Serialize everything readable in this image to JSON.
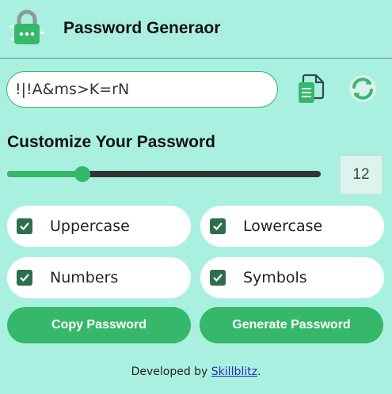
{
  "header": {
    "title": "Password Generaor",
    "logo_icon": "padlock-icon"
  },
  "password": {
    "value": "!|!A&ms>K=rN"
  },
  "actions": {
    "copy_icon": "copy-document-icon",
    "refresh_icon": "refresh-icon"
  },
  "customize": {
    "title": "Customize Your Password",
    "length": "12",
    "slider_fraction": 0.24
  },
  "options": [
    {
      "label": "Uppercase",
      "checked": true
    },
    {
      "label": "Lowercase",
      "checked": true
    },
    {
      "label": "Numbers",
      "checked": true
    },
    {
      "label": "Symbols",
      "checked": true
    }
  ],
  "buttons": {
    "copy": "Copy Password",
    "generate": "Generate Password"
  },
  "footer": {
    "prefix": "Developed by ",
    "link": "Skillblitz",
    "suffix": "."
  },
  "colors": {
    "background": "#aaf0e0",
    "accent": "#36b86a",
    "checkbox": "#2d6e4e"
  }
}
